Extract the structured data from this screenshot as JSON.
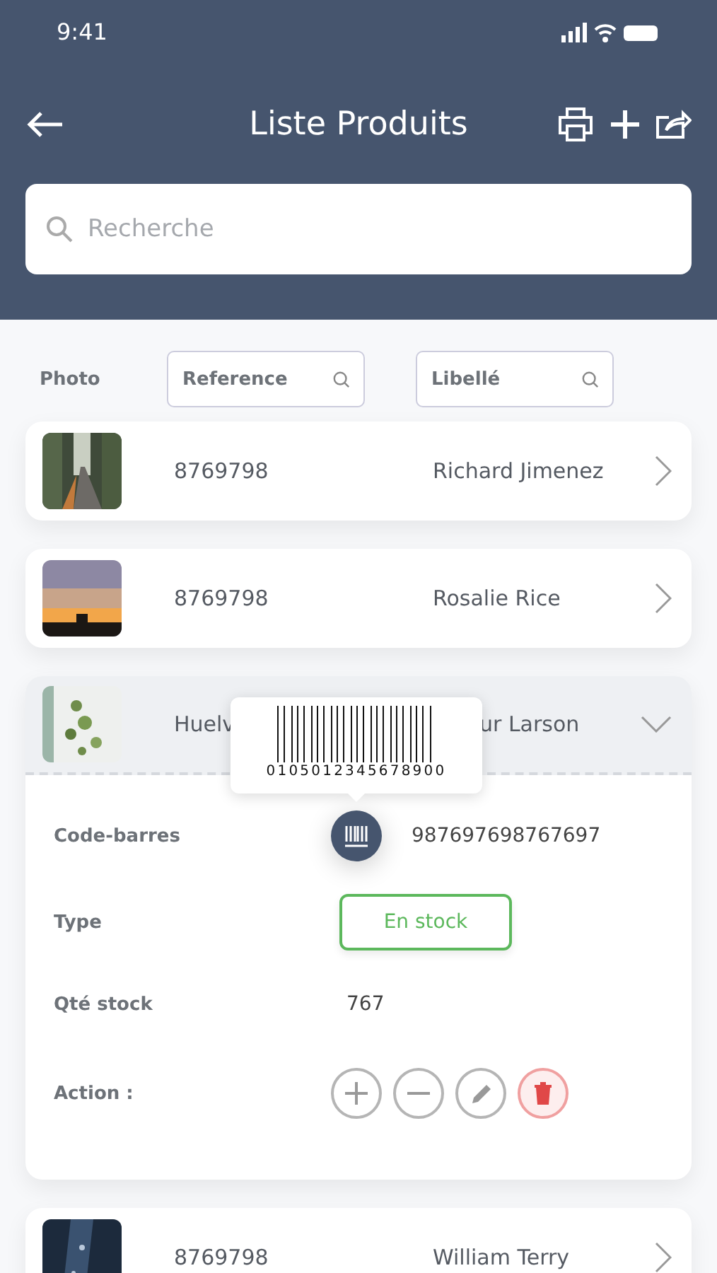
{
  "status_bar": {
    "time": "9:41"
  },
  "header": {
    "title": "Liste Produits",
    "search": {
      "placeholder": "Recherche"
    }
  },
  "columns": {
    "photo": "Photo",
    "filters": [
      {
        "placeholder": "Reference"
      },
      {
        "placeholder": "Libellé"
      }
    ]
  },
  "products": [
    {
      "reference": "8769798",
      "label": "Richard Jimenez",
      "expanded": false
    },
    {
      "reference": "8769798",
      "label": "Rosalie Rice",
      "expanded": false
    },
    {
      "reference": "Huelv",
      "label": "ur Larson",
      "expanded": true,
      "barcode_popup": "0105012345678900",
      "details": {
        "barcode_label": "Code-barres",
        "barcode": "987697698767697",
        "type_label": "Type",
        "type": {
          "text": "En stock",
          "kind": "in_stock"
        },
        "qty_label": "Qté stock",
        "qty": "767",
        "action_label": "Action :",
        "actions": [
          {
            "kind": "add"
          },
          {
            "kind": "remove"
          },
          {
            "kind": "edit"
          },
          {
            "kind": "delete"
          }
        ]
      }
    },
    {
      "reference": "8769798",
      "label": "William Terry",
      "expanded": false
    }
  ]
}
